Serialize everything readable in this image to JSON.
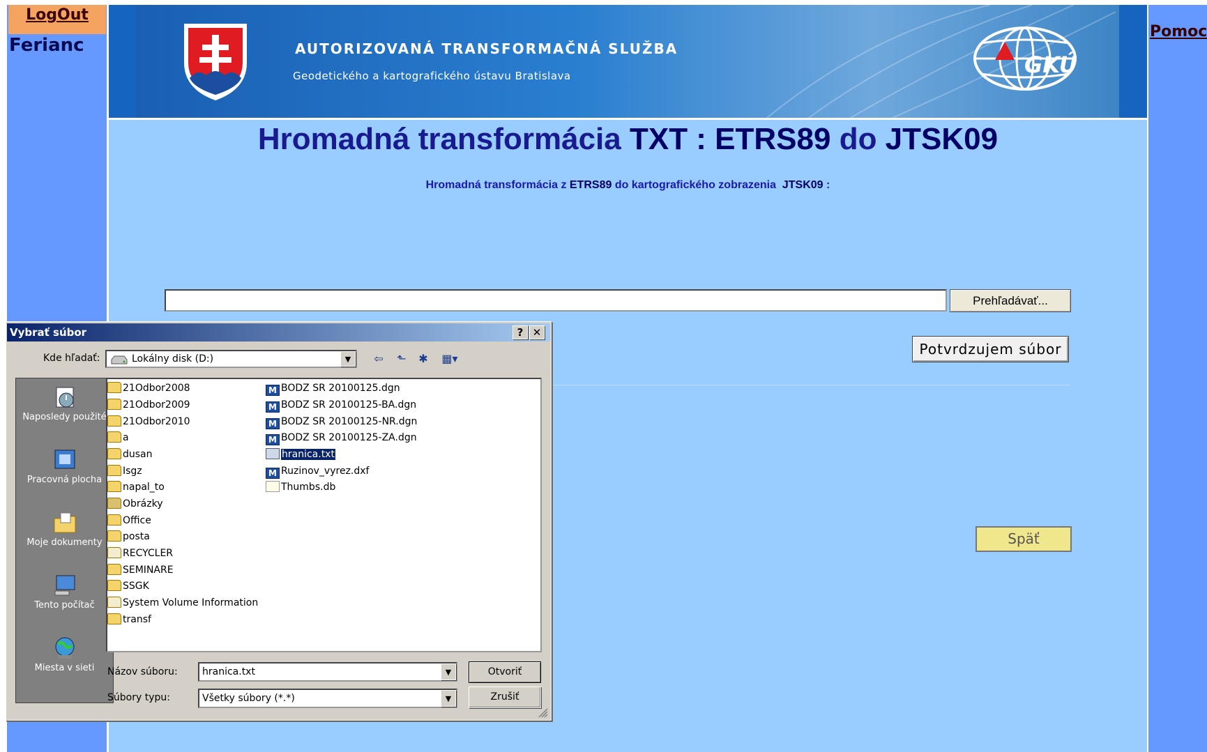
{
  "sidebar": {
    "logout_label": "LogOut",
    "user_name": "Ferianc"
  },
  "header": {
    "help_label": "Pomoc",
    "banner_title": "AUTORIZOVANÁ TRANSFORMAČNÁ SLUŽBA",
    "banner_subtitle": "Geodetického a kartografického ústavu Bratislava",
    "logo_text": "GKÚ"
  },
  "main": {
    "title_part1": "Hromadná transformácia ",
    "title_part2": "TXT : ETRS89",
    "title_part3": " do ",
    "title_part4": "JTSK09",
    "subtitle_part1": "Hromadná transformácia z ",
    "subtitle_part2": "ETRS89",
    "subtitle_part3": " do kartografického zobrazenia  ",
    "subtitle_part4": "JTSK09",
    "subtitle_part5": " :",
    "file_input_value": "",
    "browse_label": "Prehľadávať...",
    "confirm_label": "Potvrdzujem súbor",
    "back_label": "Späť"
  },
  "dialog": {
    "title": "Vybrať súbor",
    "help_btn": "?",
    "close_btn": "✕",
    "lookin_label": "Kde hľadať:",
    "lookin_value": "Lokálny disk (D:)",
    "places": [
      {
        "label": "Naposledy použité",
        "icon": "recent-icon"
      },
      {
        "label": "Pracovná plocha",
        "icon": "desktop-icon"
      },
      {
        "label": "Moje dokumenty",
        "icon": "documents-icon"
      },
      {
        "label": "Tento počítač",
        "icon": "computer-icon"
      },
      {
        "label": "Miesta v sieti",
        "icon": "network-icon"
      }
    ],
    "files_col1": [
      "21Odbor2008",
      "21Odbor2009",
      "21Odbor2010",
      "a",
      "dusan",
      "Isgz",
      "napal_to",
      "Obrázky",
      "Office",
      "posta",
      "RECYCLER",
      "SEMINARE",
      "SSGK",
      "System Volume Information",
      "transf"
    ],
    "files_col2": [
      "BODZ SR 20100125.dgn",
      "BODZ SR 20100125-BA.dgn",
      "BODZ SR 20100125-NR.dgn",
      "BODZ SR 20100125-ZA.dgn",
      "hranica.txt",
      "Ruzinov_vyrez.dxf",
      "Thumbs.db"
    ],
    "selected_file": "hranica.txt",
    "filename_label": "Názov súboru:",
    "filename_value": "hranica.txt",
    "filetype_label": "Súbory typu:",
    "filetype_value": "Všetky súbory (*.*)",
    "open_label": "Otvoriť",
    "cancel_label": "Zrušiť"
  },
  "colors": {
    "side_blue": "#6699ff",
    "main_blue": "#99ccff",
    "title_blue": "#1a1a90",
    "logout_bg": "#f4a460",
    "back_bg": "#f0e68c"
  }
}
